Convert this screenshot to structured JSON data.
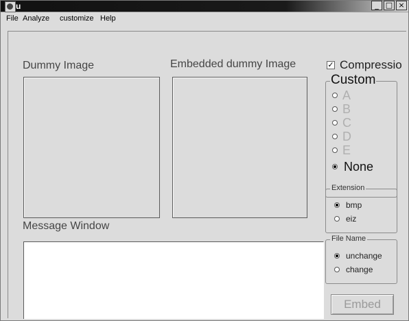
{
  "window": {
    "title": "u",
    "controls": {
      "minimize": "_",
      "maximize": "□",
      "close": "×"
    }
  },
  "menu": [
    "File",
    "Analyze",
    "customize",
    "Help"
  ],
  "labels": {
    "dummy_image": "Dummy Image",
    "embedded_dummy_image": "Embedded dummy Image",
    "message_window": "Message Window"
  },
  "compression": {
    "label": "Compressio",
    "checked": true
  },
  "custom": {
    "title": "Custom",
    "options": [
      "A",
      "B",
      "C",
      "D",
      "E",
      "None"
    ],
    "selected": "None"
  },
  "extension": {
    "title": "Extension",
    "options": [
      "bmp",
      "eiz"
    ],
    "selected": "bmp"
  },
  "file_name": {
    "title": "File Name",
    "options": [
      "unchange",
      "change"
    ],
    "selected": "unchange"
  },
  "embed_button": {
    "label": "Embed",
    "enabled": false
  },
  "message_window_text": ""
}
